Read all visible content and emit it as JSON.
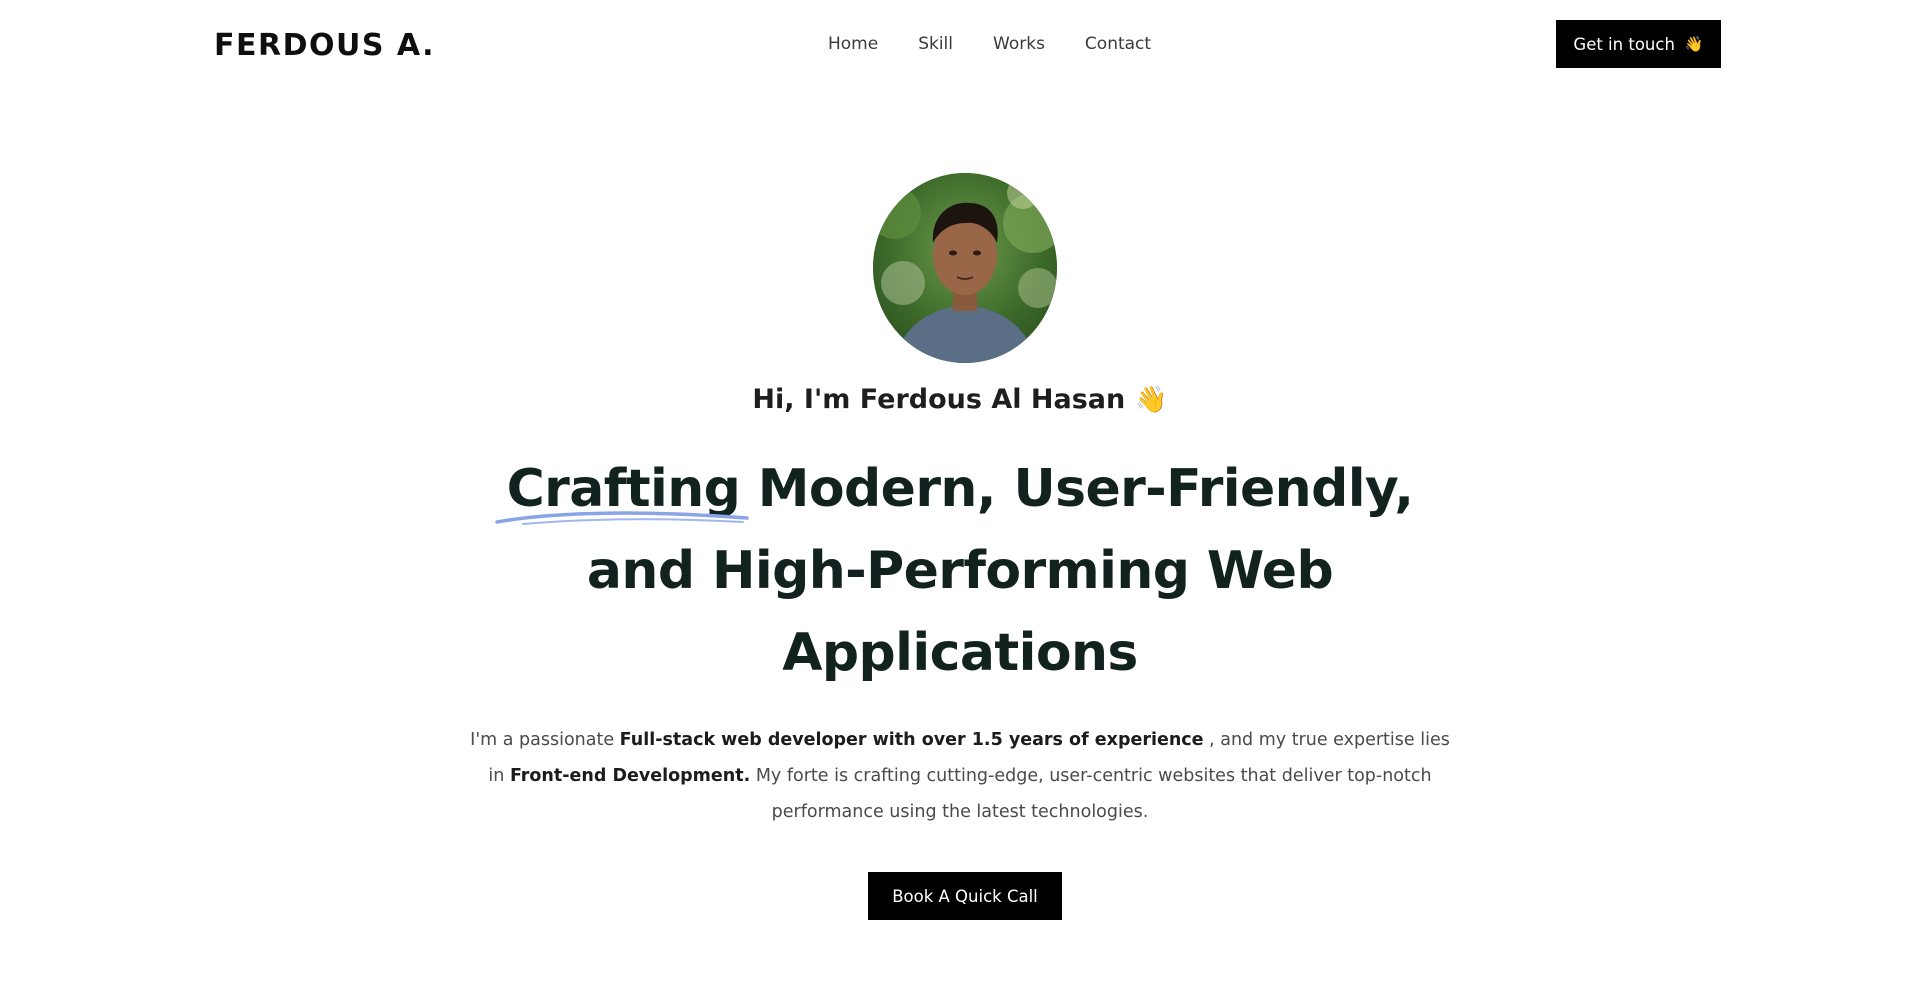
{
  "header": {
    "logo": "FERDOUS A.",
    "nav": [
      {
        "label": "Home"
      },
      {
        "label": "Skill"
      },
      {
        "label": "Works"
      },
      {
        "label": "Contact"
      }
    ],
    "cta_label": "Get in touch",
    "cta_icon": "waving-hand-icon"
  },
  "hero": {
    "avatar_alt": "profile photo",
    "greeting": "Hi, I'm Ferdous Al Hasan",
    "greeting_icon": "waving-hand-icon",
    "headline": {
      "highlight_word": "Crafting",
      "line1_rest": " Modern, User-Friendly,",
      "line2": "and High-Performing Web",
      "line3": "Applications"
    },
    "bio": {
      "part1": "I'm a passionate ",
      "bold1": "Full-stack web developer with over 1.5 years of experience",
      "part2": " , and my true expertise lies in ",
      "bold2": "Front-end Development.",
      "part3": " My forte is crafting cutting-edge, user-centric websites that deliver top-notch performance using the latest technologies."
    },
    "cta_label": "Book A Quick Call"
  },
  "colors": {
    "button_bg": "#000000",
    "button_text": "#ffffff",
    "headline": "#12221f",
    "scribble": "#8aa4e8"
  }
}
